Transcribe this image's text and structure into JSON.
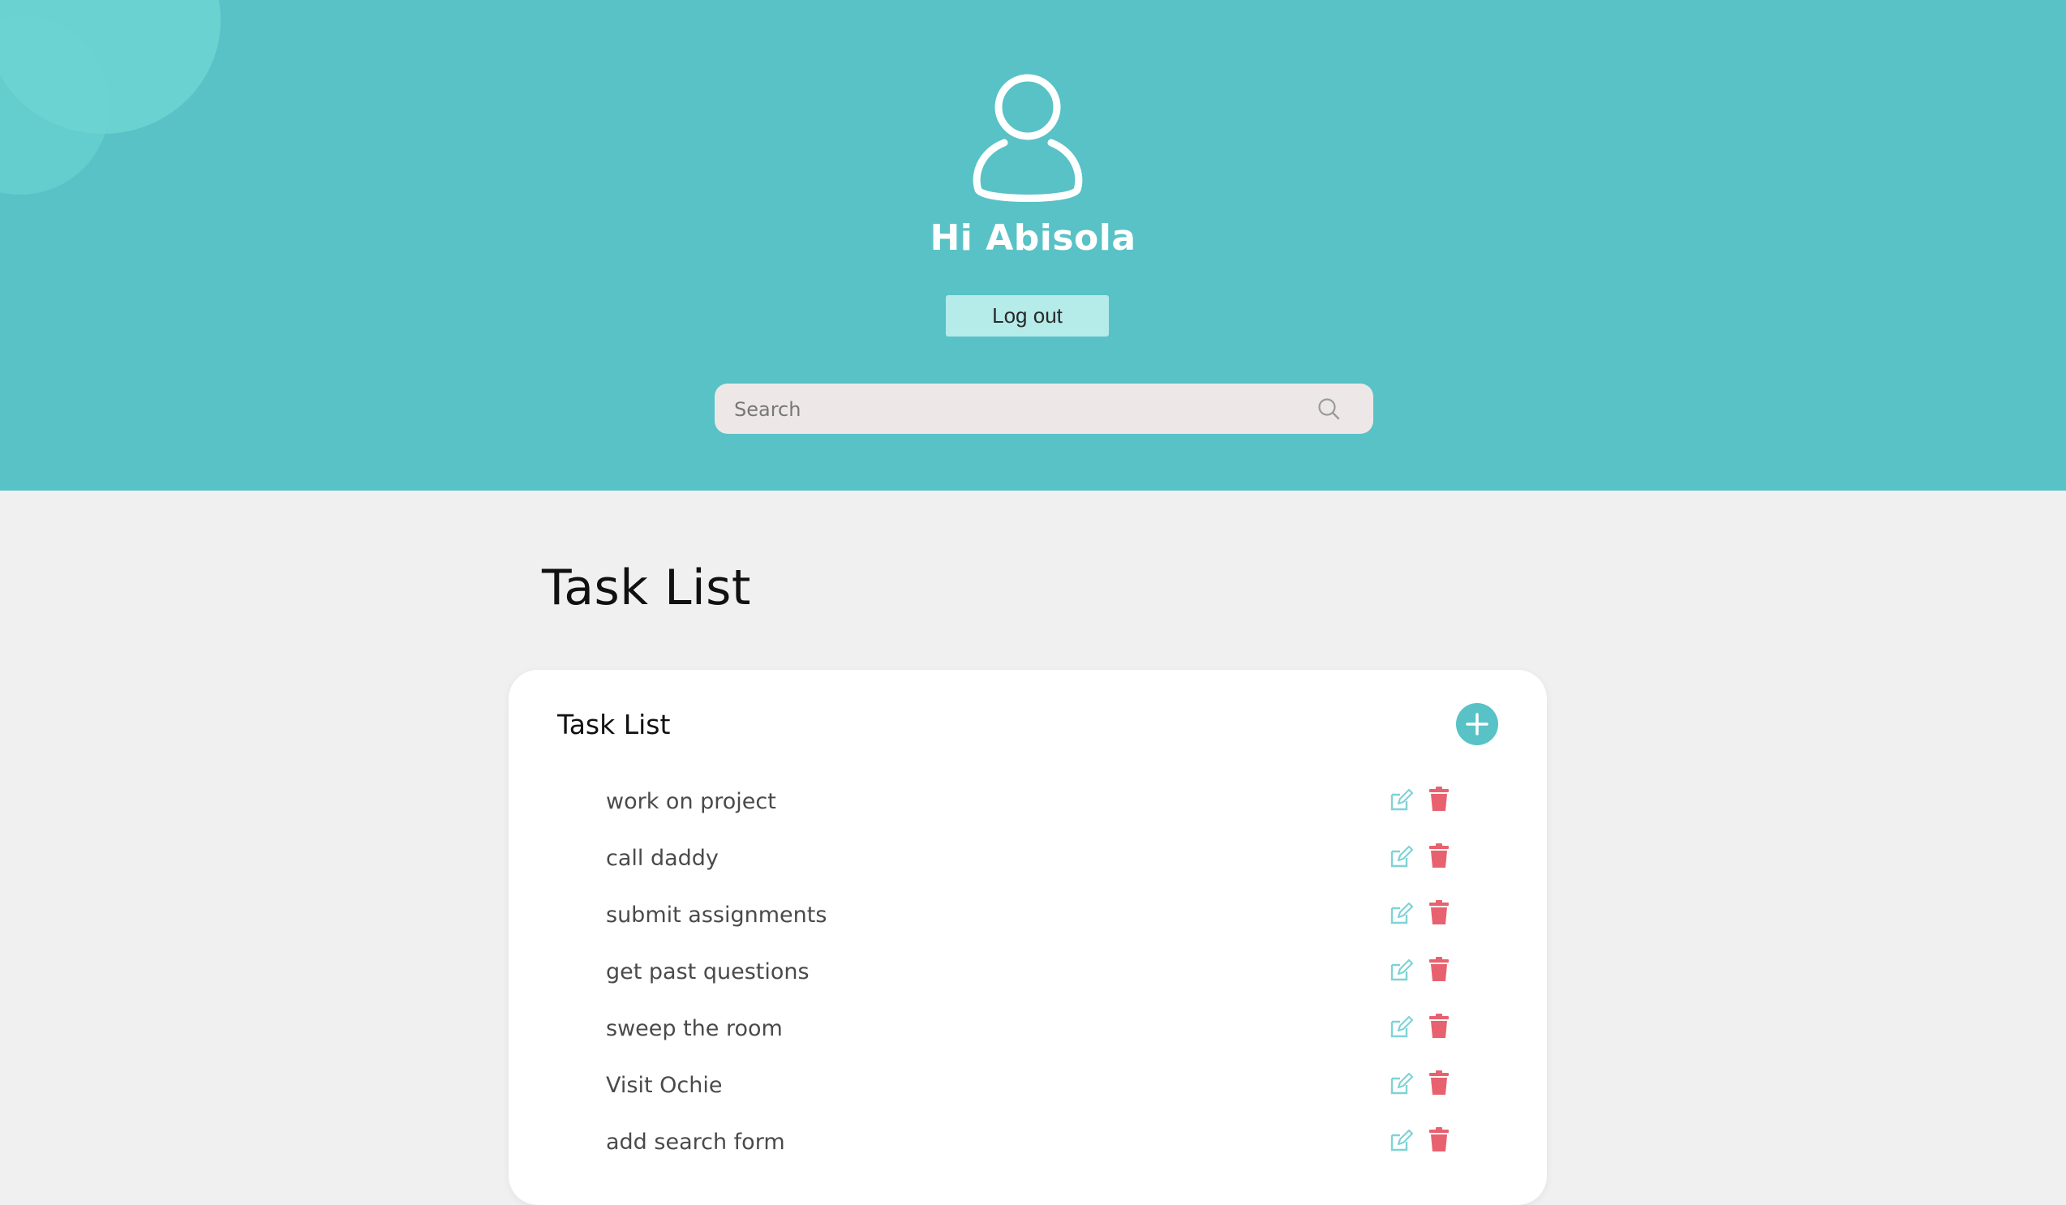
{
  "header": {
    "greeting": "Hi Abisola",
    "logout_label": "Log out",
    "avatar_icon": "user-icon"
  },
  "search": {
    "placeholder": "Search",
    "value": "",
    "icon": "search-icon"
  },
  "main": {
    "title": "Task List",
    "card": {
      "title": "Task List",
      "add_icon": "plus-icon",
      "tasks": [
        {
          "label": "work on project",
          "edit_icon": "edit-icon",
          "delete_icon": "trash-icon"
        },
        {
          "label": "call daddy",
          "edit_icon": "edit-icon",
          "delete_icon": "trash-icon"
        },
        {
          "label": "submit assignments",
          "edit_icon": "edit-icon",
          "delete_icon": "trash-icon"
        },
        {
          "label": "get past questions",
          "edit_icon": "edit-icon",
          "delete_icon": "trash-icon"
        },
        {
          "label": "sweep the room",
          "edit_icon": "edit-icon",
          "delete_icon": "trash-icon"
        },
        {
          "label": "Visit Ochie",
          "edit_icon": "edit-icon",
          "delete_icon": "trash-icon"
        },
        {
          "label": "add search form",
          "edit_icon": "edit-icon",
          "delete_icon": "trash-icon"
        }
      ]
    }
  },
  "colors": {
    "header_bg": "#58c2c6",
    "accent": "#58c2c6",
    "logout_bg": "#b5ebe9",
    "delete": "#e8616f",
    "edit": "#7fd3d6",
    "page_bg": "#f0f0f0"
  }
}
